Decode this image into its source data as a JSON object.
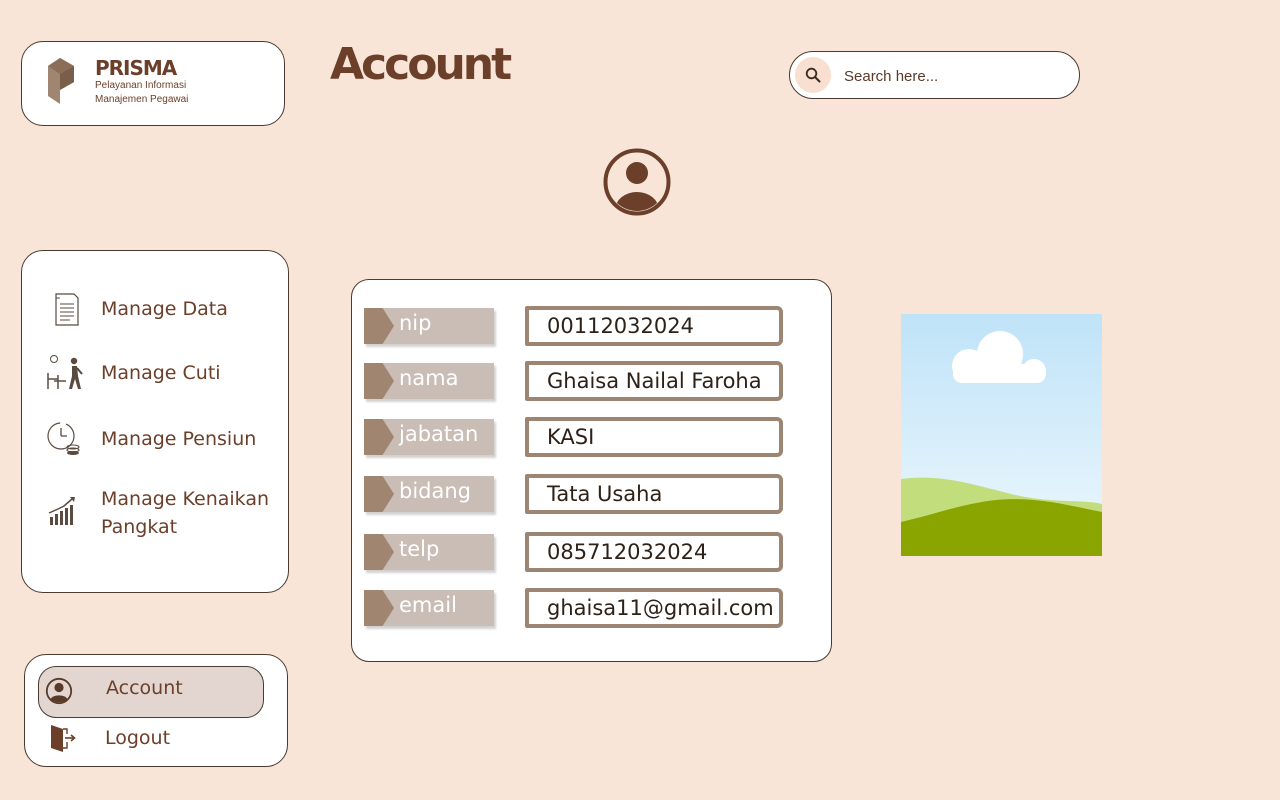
{
  "brand": {
    "name": "PRISMA",
    "subtitle_line1": "Pelayanan Informasi",
    "subtitle_line2": "Manajemen Pegawai"
  },
  "page": {
    "title": "Account"
  },
  "search": {
    "placeholder": "Search here...",
    "value": ""
  },
  "sidebar": {
    "items": [
      {
        "label": "Manage Data",
        "icon": "document-icon"
      },
      {
        "label": "Manage Cuti",
        "icon": "leave-walk-icon"
      },
      {
        "label": "Manage Pensiun",
        "icon": "pension-clock-icon"
      },
      {
        "label": "Manage Kenaikan Pangkat",
        "icon": "growth-chart-icon"
      }
    ]
  },
  "account_menu": {
    "account_label": "Account",
    "logout_label": "Logout"
  },
  "profile": {
    "fields": [
      {
        "label": "nip",
        "value": "00112032024"
      },
      {
        "label": "nama",
        "value": "Ghaisa Nailal Faroha"
      },
      {
        "label": "jabatan",
        "value": "KASI"
      },
      {
        "label": "bidang",
        "value": "Tata Usaha"
      },
      {
        "label": "telp",
        "value": "085712032024"
      },
      {
        "label": "email",
        "value": "ghaisa11@gmail.com"
      }
    ]
  },
  "colors": {
    "background": "#f8e5d8",
    "brown_text": "#6b3f2a",
    "label_fill": "#c9bdb5",
    "label_tab": "#a08670",
    "value_border": "#9c8573",
    "active_item": "#e3d6d0"
  }
}
